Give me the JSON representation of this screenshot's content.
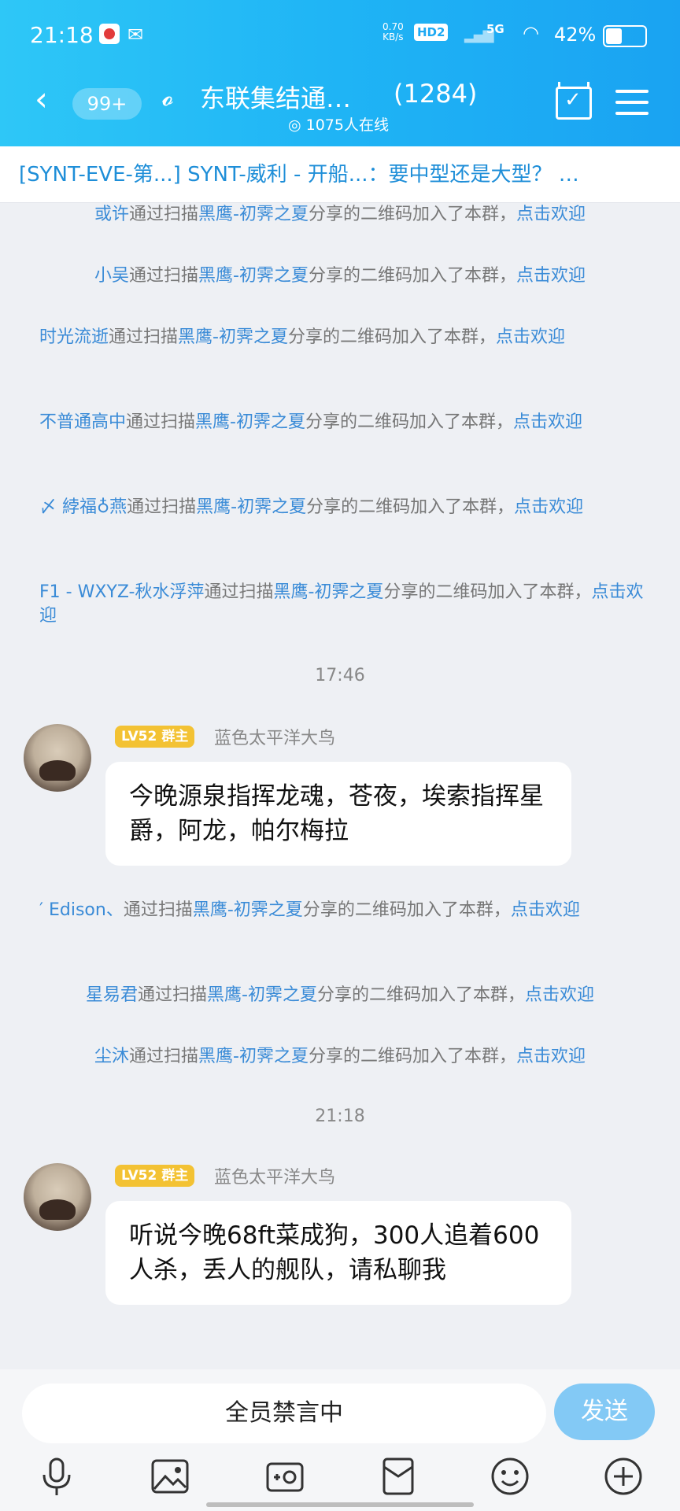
{
  "status": {
    "time": "21:18",
    "net_speed": "0.70",
    "net_unit": "KB/s",
    "hd": "HD2",
    "net_type": "5G",
    "battery_pct": "42%",
    "battery_level": 0.42
  },
  "header": {
    "unread_badge": "99+",
    "title": "东联集结通…",
    "member_count": "(1284)",
    "online_text": "1075人在线"
  },
  "pinned": {
    "text": "[SYNT-EVE-第...] SYNT-威利 - 开船...：要中型还是大型？ …"
  },
  "system_messages_1": [
    {
      "name": "或许",
      "mid": "通过扫描",
      "inviter": "黑鹰-初霁之夏",
      "tail": "分享的二维码加入了本群，",
      "action": "点击欢迎"
    },
    {
      "name": "小吴",
      "mid": "通过扫描",
      "inviter": "黑鹰-初霁之夏",
      "tail": "分享的二维码加入了本群，",
      "action": "点击欢迎"
    },
    {
      "name": "时光流逝",
      "mid": "通过扫描",
      "inviter": "黑鹰-初霁之夏",
      "tail": "分享的二维码加入了本群，",
      "action": "点击欢迎"
    },
    {
      "name": "不普通高中",
      "mid": "通过扫描",
      "inviter": "黑鹰-初霁之夏",
      "tail": "分享的二维码加入了本群，",
      "action": "点击欢迎"
    },
    {
      "name": "〆 綍福♁燕",
      "mid": "通过扫描",
      "inviter": "黑鹰-初霁之夏",
      "tail": "分享的二维码加入了本群，",
      "action": "点击欢迎"
    },
    {
      "name": "F1 - WXYZ-秋水浮萍",
      "mid": "通过扫描",
      "inviter": "黑鹰-初霁之夏",
      "tail": "分享的二维码加入了本群，",
      "action": "点击欢迎"
    }
  ],
  "time_1": "17:46",
  "msg_1": {
    "level": "LV52",
    "role": "群主",
    "sender": "蓝色太平洋大鸟",
    "text": "今晚源泉指挥龙魂，苍夜，埃索指挥星爵，阿龙，帕尔梅拉"
  },
  "system_messages_2": [
    {
      "name": "′ Edison、",
      "mid": "通过扫描",
      "inviter": "黑鹰-初霁之夏",
      "tail": "分享的二维码加入了本群，",
      "action": "点击欢迎"
    },
    {
      "name": "星易君",
      "mid": "通过扫描",
      "inviter": "黑鹰-初霁之夏",
      "tail": "分享的二维码加入了本群，",
      "action": "点击欢迎"
    },
    {
      "name": "尘沐",
      "mid": "通过扫描",
      "inviter": "黑鹰-初霁之夏",
      "tail": "分享的二维码加入了本群，",
      "action": "点击欢迎"
    }
  ],
  "time_2": "21:18",
  "msg_2": {
    "level": "LV52",
    "role": "群主",
    "sender": "蓝色太平洋大鸟",
    "text": "听说今晚68ft菜成狗，300人追着600人杀，丢人的舰队，请私聊我"
  },
  "input": {
    "placeholder": "全员禁言中",
    "send_label": "发送"
  },
  "toolbar_icons": [
    "microphone-icon",
    "image-icon",
    "camera-icon",
    "red-envelope-icon",
    "emoji-icon",
    "plus-icon"
  ]
}
